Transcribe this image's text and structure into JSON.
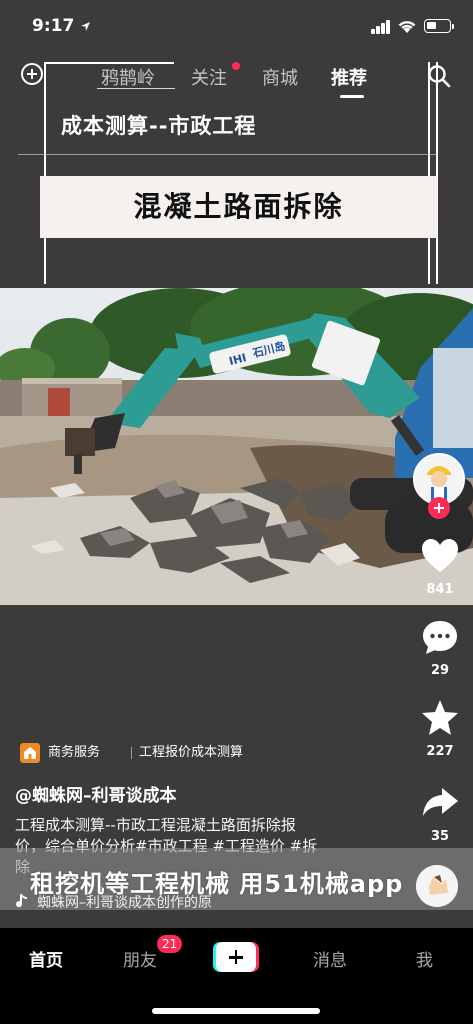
{
  "status_bar": {
    "time": "9:17"
  },
  "top_nav": {
    "tabs": [
      {
        "label": "鸦鹊岭"
      },
      {
        "label": "关注"
      },
      {
        "label": "商城"
      },
      {
        "label": "推荐"
      }
    ],
    "active_tab": "推荐"
  },
  "slide": {
    "subtitle": "成本测算--市政工程",
    "banner_title": "混凝土路面拆除",
    "photo_texts": {
      "brand_ihi": "IHI",
      "brand_cn": "石川岛"
    }
  },
  "rail": {
    "likes": "841",
    "comments": "29",
    "favorites": "227",
    "shares": "35"
  },
  "caption": {
    "service_label": "商务服务",
    "service_detail": "工程报价成本测算",
    "author": "@蜘蛛网–利哥谈成本",
    "description_line1": "工程成本测算--市政工程混凝土路面拆除报",
    "description_line2": "价，综合单价分析#市政工程 #工程造价 #拆",
    "description_line3": "除",
    "music": "蜘蛛网–利哥谈成本创作的原"
  },
  "ad_overlay": {
    "text": "租挖机等工程机械  用51机械app"
  },
  "bottom_nav": {
    "items": [
      {
        "label": "首页"
      },
      {
        "label": "朋友"
      },
      {
        "label": "消息"
      },
      {
        "label": "我"
      }
    ],
    "friends_badge": "21"
  },
  "colors": {
    "accent": "#fe2c55",
    "cyan": "#25f4ee",
    "banner_bg": "#f5f1ee",
    "bg": "#3c3a3b"
  }
}
